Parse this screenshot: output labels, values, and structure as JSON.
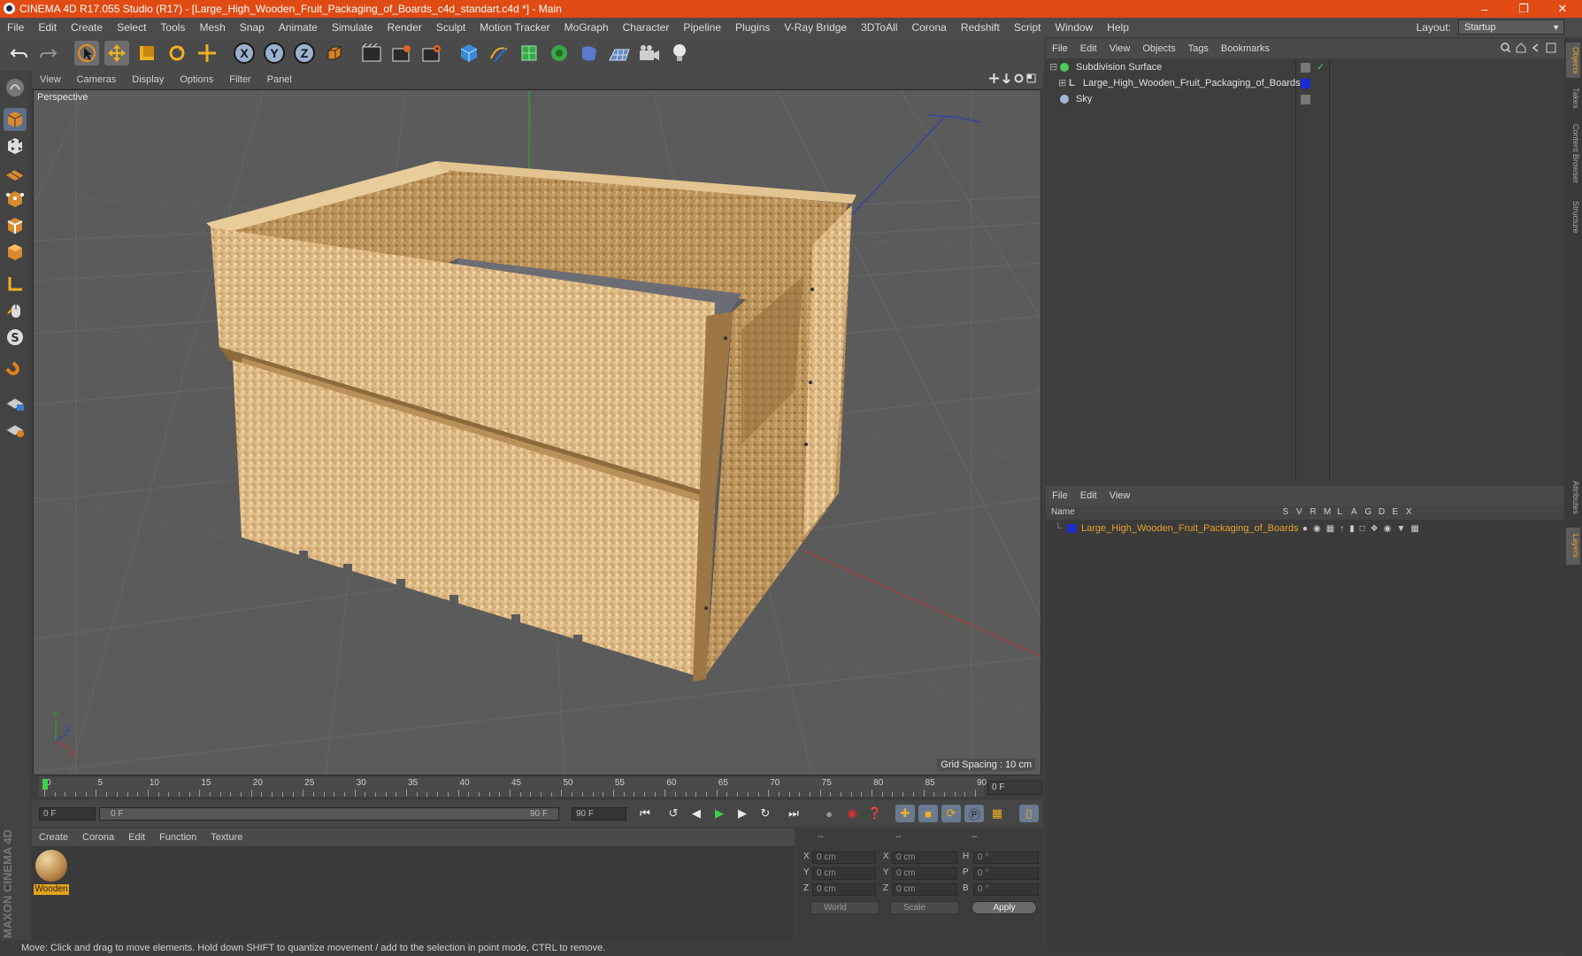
{
  "window": {
    "title": "CINEMA 4D R17.055 Studio (R17) - [Large_High_Wooden_Fruit_Packaging_of_Boards_c4d_standart.c4d *] - Main",
    "minimize_glyph": "–",
    "restore_glyph": "❐",
    "close_glyph": "✕"
  },
  "menubar": {
    "items": [
      "File",
      "Edit",
      "Create",
      "Select",
      "Tools",
      "Mesh",
      "Snap",
      "Animate",
      "Simulate",
      "Render",
      "Sculpt",
      "Motion Tracker",
      "MoGraph",
      "Character",
      "Pipeline",
      "Plugins",
      "V-Ray Bridge",
      "3DToAll",
      "Corona",
      "Redshift",
      "Script",
      "Window",
      "Help"
    ],
    "layout_label": "Layout:",
    "layout_value": "Startup"
  },
  "toolbar": {
    "axis_x": "X",
    "axis_y": "Y",
    "axis_z": "Z"
  },
  "viewport": {
    "menu": [
      "View",
      "Cameras",
      "Display",
      "Options",
      "Filter",
      "Panel"
    ],
    "label": "Perspective",
    "grid_spacing": "Grid Spacing : 10 cm",
    "axis_x_color": "#c03030",
    "axis_y_color": "#2fa02f",
    "axis_z_color": "#3040b0"
  },
  "timeline": {
    "ticks": [
      "0",
      "5",
      "10",
      "15",
      "20",
      "25",
      "30",
      "35",
      "40",
      "45",
      "50",
      "55",
      "60",
      "65",
      "70",
      "75",
      "80",
      "85",
      "90"
    ],
    "current_frame_field": "0 F",
    "start_field": "0 F",
    "range_start": "0 F",
    "range_end": "90 F",
    "end_field": "90 F"
  },
  "materials": {
    "menu": [
      "Create",
      "Corona",
      "Edit",
      "Function",
      "Texture"
    ],
    "items": [
      {
        "name": "Wooden"
      }
    ]
  },
  "coordinates": {
    "header": [
      "--",
      "--",
      "--"
    ],
    "rows": [
      {
        "axis": "X",
        "pos": "0 cm",
        "axis2": "X",
        "size": "0 cm",
        "rot_label": "H",
        "rot": "0 °"
      },
      {
        "axis": "Y",
        "pos": "0 cm",
        "axis2": "Y",
        "size": "0 cm",
        "rot_label": "P",
        "rot": "0 °"
      },
      {
        "axis": "Z",
        "pos": "0 cm",
        "axis2": "Z",
        "size": "0 cm",
        "rot_label": "B",
        "rot": "0 °"
      }
    ],
    "space_dropdown": "World",
    "mode_dropdown": "Scale",
    "apply_label": "Apply"
  },
  "objects": {
    "menu": [
      "File",
      "Edit",
      "View",
      "Objects",
      "Tags",
      "Bookmarks"
    ],
    "items": [
      {
        "name": "Subdivision Surface",
        "indent": 0,
        "color": "#4ecb5a"
      },
      {
        "name": "Large_High_Wooden_Fruit_Packaging_of_Boards",
        "indent": 1,
        "color": "#bfbfbf"
      },
      {
        "name": "Sky",
        "indent": 0,
        "color": "#9fb6d6"
      }
    ]
  },
  "layers": {
    "menu": [
      "File",
      "Edit",
      "View"
    ],
    "columns": [
      "Name",
      "S",
      "V",
      "R",
      "M",
      "L",
      "A",
      "G",
      "D",
      "E",
      "X"
    ],
    "items": [
      {
        "name": "Large_High_Wooden_Fruit_Packaging_of_Boards",
        "color": "#1a2bd0"
      }
    ]
  },
  "right_tabs": [
    "Objects",
    "Takes",
    "Content Browser",
    "Structure",
    "Attributes",
    "Layers"
  ],
  "logo": {
    "line1": "MAXON",
    "line2": "CINEMA 4D"
  },
  "status": "Move: Click and drag to move elements. Hold down SHIFT to quantize movement / add to the selection in point mode, CTRL to remove.",
  "colors": {
    "title_bar": "#e04a13",
    "accent": "#e5a11a",
    "wood_light": "#e2c28e",
    "wood_dark": "#a27a45"
  }
}
